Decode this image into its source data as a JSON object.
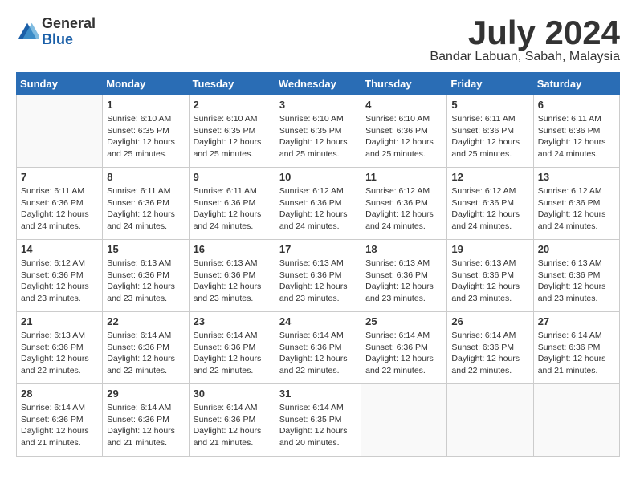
{
  "logo": {
    "general": "General",
    "blue": "Blue"
  },
  "title": "July 2024",
  "location": "Bandar Labuan, Sabah, Malaysia",
  "days_of_week": [
    "Sunday",
    "Monday",
    "Tuesday",
    "Wednesday",
    "Thursday",
    "Friday",
    "Saturday"
  ],
  "weeks": [
    [
      {
        "day": "",
        "info": ""
      },
      {
        "day": "1",
        "info": "Sunrise: 6:10 AM\nSunset: 6:35 PM\nDaylight: 12 hours\nand 25 minutes."
      },
      {
        "day": "2",
        "info": "Sunrise: 6:10 AM\nSunset: 6:35 PM\nDaylight: 12 hours\nand 25 minutes."
      },
      {
        "day": "3",
        "info": "Sunrise: 6:10 AM\nSunset: 6:35 PM\nDaylight: 12 hours\nand 25 minutes."
      },
      {
        "day": "4",
        "info": "Sunrise: 6:10 AM\nSunset: 6:36 PM\nDaylight: 12 hours\nand 25 minutes."
      },
      {
        "day": "5",
        "info": "Sunrise: 6:11 AM\nSunset: 6:36 PM\nDaylight: 12 hours\nand 25 minutes."
      },
      {
        "day": "6",
        "info": "Sunrise: 6:11 AM\nSunset: 6:36 PM\nDaylight: 12 hours\nand 24 minutes."
      }
    ],
    [
      {
        "day": "7",
        "info": ""
      },
      {
        "day": "8",
        "info": "Sunrise: 6:11 AM\nSunset: 6:36 PM\nDaylight: 12 hours\nand 24 minutes."
      },
      {
        "day": "9",
        "info": "Sunrise: 6:11 AM\nSunset: 6:36 PM\nDaylight: 12 hours\nand 24 minutes."
      },
      {
        "day": "10",
        "info": "Sunrise: 6:12 AM\nSunset: 6:36 PM\nDaylight: 12 hours\nand 24 minutes."
      },
      {
        "day": "11",
        "info": "Sunrise: 6:12 AM\nSunset: 6:36 PM\nDaylight: 12 hours\nand 24 minutes."
      },
      {
        "day": "12",
        "info": "Sunrise: 6:12 AM\nSunset: 6:36 PM\nDaylight: 12 hours\nand 24 minutes."
      },
      {
        "day": "13",
        "info": "Sunrise: 6:12 AM\nSunset: 6:36 PM\nDaylight: 12 hours\nand 24 minutes."
      }
    ],
    [
      {
        "day": "14",
        "info": ""
      },
      {
        "day": "15",
        "info": "Sunrise: 6:13 AM\nSunset: 6:36 PM\nDaylight: 12 hours\nand 23 minutes."
      },
      {
        "day": "16",
        "info": "Sunrise: 6:13 AM\nSunset: 6:36 PM\nDaylight: 12 hours\nand 23 minutes."
      },
      {
        "day": "17",
        "info": "Sunrise: 6:13 AM\nSunset: 6:36 PM\nDaylight: 12 hours\nand 23 minutes."
      },
      {
        "day": "18",
        "info": "Sunrise: 6:13 AM\nSunset: 6:36 PM\nDaylight: 12 hours\nand 23 minutes."
      },
      {
        "day": "19",
        "info": "Sunrise: 6:13 AM\nSunset: 6:36 PM\nDaylight: 12 hours\nand 23 minutes."
      },
      {
        "day": "20",
        "info": "Sunrise: 6:13 AM\nSunset: 6:36 PM\nDaylight: 12 hours\nand 23 minutes."
      }
    ],
    [
      {
        "day": "21",
        "info": ""
      },
      {
        "day": "22",
        "info": "Sunrise: 6:14 AM\nSunset: 6:36 PM\nDaylight: 12 hours\nand 22 minutes."
      },
      {
        "day": "23",
        "info": "Sunrise: 6:14 AM\nSunset: 6:36 PM\nDaylight: 12 hours\nand 22 minutes."
      },
      {
        "day": "24",
        "info": "Sunrise: 6:14 AM\nSunset: 6:36 PM\nDaylight: 12 hours\nand 22 minutes."
      },
      {
        "day": "25",
        "info": "Sunrise: 6:14 AM\nSunset: 6:36 PM\nDaylight: 12 hours\nand 22 minutes."
      },
      {
        "day": "26",
        "info": "Sunrise: 6:14 AM\nSunset: 6:36 PM\nDaylight: 12 hours\nand 22 minutes."
      },
      {
        "day": "27",
        "info": "Sunrise: 6:14 AM\nSunset: 6:36 PM\nDaylight: 12 hours\nand 21 minutes."
      }
    ],
    [
      {
        "day": "28",
        "info": "Sunrise: 6:14 AM\nSunset: 6:36 PM\nDaylight: 12 hours\nand 21 minutes."
      },
      {
        "day": "29",
        "info": "Sunrise: 6:14 AM\nSunset: 6:36 PM\nDaylight: 12 hours\nand 21 minutes."
      },
      {
        "day": "30",
        "info": "Sunrise: 6:14 AM\nSunset: 6:36 PM\nDaylight: 12 hours\nand 21 minutes."
      },
      {
        "day": "31",
        "info": "Sunrise: 6:14 AM\nSunset: 6:35 PM\nDaylight: 12 hours\nand 20 minutes."
      },
      {
        "day": "",
        "info": ""
      },
      {
        "day": "",
        "info": ""
      },
      {
        "day": "",
        "info": ""
      }
    ]
  ],
  "week7_sunday": "Sunrise: 6:11 AM\nSunset: 6:36 PM\nDaylight: 12 hours\nand 24 minutes.",
  "week14_sunday": "Sunrise: 6:12 AM\nSunset: 6:36 PM\nDaylight: 12 hours\nand 23 minutes.",
  "week21_sunday": "Sunrise: 6:13 AM\nSunset: 6:36 PM\nDaylight: 12 hours\nand 22 minutes."
}
